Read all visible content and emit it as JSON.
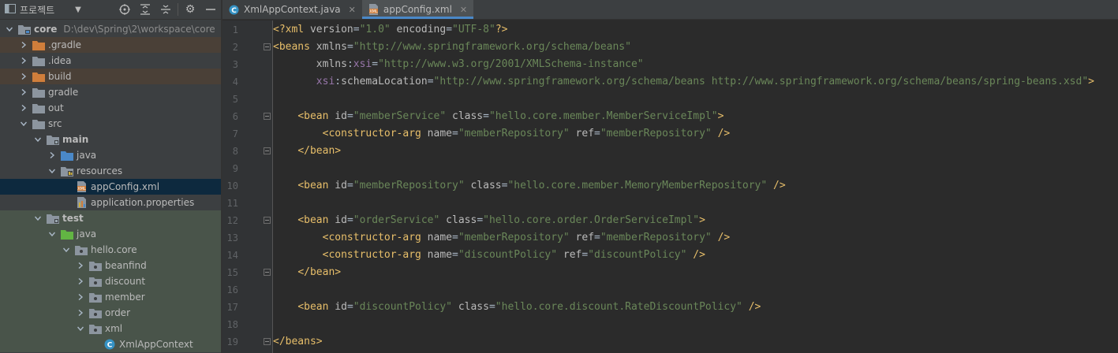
{
  "project_panel": {
    "title": "프로젝트",
    "tree": [
      {
        "id": "core",
        "label": "core",
        "path": "D:\\dev\\Spring\\2\\workspace\\core",
        "depth": 0,
        "type": "module",
        "expanded": true,
        "bold": true
      },
      {
        "id": "gradle-dot",
        "label": ".gradle",
        "depth": 1,
        "type": "folder-orange",
        "expanded": false,
        "bg": "excluded"
      },
      {
        "id": "idea",
        "label": ".idea",
        "depth": 1,
        "type": "folder",
        "expanded": false
      },
      {
        "id": "build",
        "label": "build",
        "depth": 1,
        "type": "folder-orange",
        "expanded": false,
        "bg": "excluded"
      },
      {
        "id": "gradle",
        "label": "gradle",
        "depth": 1,
        "type": "folder",
        "expanded": false
      },
      {
        "id": "out",
        "label": "out",
        "depth": 1,
        "type": "folder",
        "expanded": false
      },
      {
        "id": "src",
        "label": "src",
        "depth": 1,
        "type": "folder",
        "expanded": true
      },
      {
        "id": "main",
        "label": "main",
        "depth": 2,
        "type": "folder-src",
        "expanded": true,
        "bold": true
      },
      {
        "id": "main-java",
        "label": "java",
        "depth": 3,
        "type": "folder-blue",
        "expanded": false
      },
      {
        "id": "resources",
        "label": "resources",
        "depth": 3,
        "type": "folder-res",
        "expanded": true
      },
      {
        "id": "appconfig",
        "label": "appConfig.xml",
        "depth": 4,
        "type": "xml",
        "bg": "selected"
      },
      {
        "id": "app-props",
        "label": "application.properties",
        "depth": 4,
        "type": "props"
      },
      {
        "id": "test",
        "label": "test",
        "depth": 2,
        "type": "folder-src",
        "expanded": true,
        "bold": true,
        "bg": "testsrc"
      },
      {
        "id": "test-java",
        "label": "java",
        "depth": 3,
        "type": "folder-green",
        "expanded": true,
        "bg": "testsrc"
      },
      {
        "id": "hello-core",
        "label": "hello.core",
        "depth": 4,
        "type": "package",
        "expanded": true,
        "bg": "testsrc"
      },
      {
        "id": "beanfind",
        "label": "beanfind",
        "depth": 5,
        "type": "package",
        "expanded": false,
        "bg": "testsrc"
      },
      {
        "id": "discount",
        "label": "discount",
        "depth": 5,
        "type": "package",
        "expanded": false,
        "bg": "testsrc"
      },
      {
        "id": "member",
        "label": "member",
        "depth": 5,
        "type": "package",
        "expanded": false,
        "bg": "testsrc"
      },
      {
        "id": "order",
        "label": "order",
        "depth": 5,
        "type": "package",
        "expanded": false,
        "bg": "testsrc"
      },
      {
        "id": "xml",
        "label": "xml",
        "depth": 5,
        "type": "package",
        "expanded": true,
        "bg": "testsrc"
      },
      {
        "id": "xmlappcontext",
        "label": "XmlAppContext",
        "depth": 6,
        "type": "class",
        "bg": "testsrc"
      }
    ]
  },
  "tabs": [
    {
      "label": "XmlAppContext.java",
      "icon": "class-icon",
      "active": false
    },
    {
      "label": "appConfig.xml",
      "icon": "xml-file-icon",
      "active": true
    }
  ],
  "editor": {
    "fold_lines": [
      2,
      6,
      8,
      12,
      15,
      19
    ],
    "lines": [
      [
        [
          "ang",
          "<?"
        ],
        [
          "tag",
          "xml"
        ],
        [
          "attr",
          " version"
        ],
        [
          "txt",
          "="
        ],
        [
          "val",
          "\"1.0\""
        ],
        [
          "attr",
          " encoding"
        ],
        [
          "txt",
          "="
        ],
        [
          "val",
          "\"UTF-8\""
        ],
        [
          "ang",
          "?>"
        ]
      ],
      [
        [
          "ang",
          "<"
        ],
        [
          "tag",
          "beans"
        ],
        [
          "attr",
          " xmlns"
        ],
        [
          "txt",
          "="
        ],
        [
          "val",
          "\"http://www.springframework.org/schema/beans\""
        ]
      ],
      [
        [
          "txt",
          "       "
        ],
        [
          "attr",
          "xmlns"
        ],
        [
          "txt",
          ":"
        ],
        [
          "ns",
          "xsi"
        ],
        [
          "txt",
          "="
        ],
        [
          "val",
          "\"http://www.w3.org/2001/XMLSchema-instance\""
        ]
      ],
      [
        [
          "txt",
          "       "
        ],
        [
          "ns",
          "xsi"
        ],
        [
          "txt",
          ":"
        ],
        [
          "attr",
          "schemaLocation"
        ],
        [
          "txt",
          "="
        ],
        [
          "val",
          "\"http://www.springframework.org/schema/beans http://www.springframework.org/schema/beans/spring-beans.xsd\""
        ],
        [
          "ang",
          ">"
        ]
      ],
      [],
      [
        [
          "txt",
          "    "
        ],
        [
          "ang",
          "<"
        ],
        [
          "tag",
          "bean"
        ],
        [
          "attr",
          " id"
        ],
        [
          "txt",
          "="
        ],
        [
          "val",
          "\"memberService\""
        ],
        [
          "attr",
          " class"
        ],
        [
          "txt",
          "="
        ],
        [
          "val",
          "\"hello.core.member.MemberServiceImpl\""
        ],
        [
          "ang",
          ">"
        ]
      ],
      [
        [
          "txt",
          "        "
        ],
        [
          "ang",
          "<"
        ],
        [
          "tag",
          "constructor-arg"
        ],
        [
          "attr",
          " name"
        ],
        [
          "txt",
          "="
        ],
        [
          "val",
          "\"memberRepository\""
        ],
        [
          "attr",
          " ref"
        ],
        [
          "txt",
          "="
        ],
        [
          "val",
          "\"memberRepository\""
        ],
        [
          "ang",
          " />"
        ]
      ],
      [
        [
          "txt",
          "    "
        ],
        [
          "ang",
          "</"
        ],
        [
          "tag",
          "bean"
        ],
        [
          "ang",
          ">"
        ]
      ],
      [],
      [
        [
          "txt",
          "    "
        ],
        [
          "ang",
          "<"
        ],
        [
          "tag",
          "bean"
        ],
        [
          "attr",
          " id"
        ],
        [
          "txt",
          "="
        ],
        [
          "val",
          "\"memberRepository\""
        ],
        [
          "attr",
          " class"
        ],
        [
          "txt",
          "="
        ],
        [
          "val",
          "\"hello.core.member.MemoryMemberRepository\""
        ],
        [
          "ang",
          " />"
        ]
      ],
      [],
      [
        [
          "txt",
          "    "
        ],
        [
          "ang",
          "<"
        ],
        [
          "tag",
          "bean"
        ],
        [
          "attr",
          " id"
        ],
        [
          "txt",
          "="
        ],
        [
          "val",
          "\"orderService\""
        ],
        [
          "attr",
          " class"
        ],
        [
          "txt",
          "="
        ],
        [
          "val",
          "\"hello.core.order.OrderServiceImpl\""
        ],
        [
          "ang",
          ">"
        ]
      ],
      [
        [
          "txt",
          "        "
        ],
        [
          "ang",
          "<"
        ],
        [
          "tag",
          "constructor-arg"
        ],
        [
          "attr",
          " name"
        ],
        [
          "txt",
          "="
        ],
        [
          "val",
          "\"memberRepository\""
        ],
        [
          "attr",
          " ref"
        ],
        [
          "txt",
          "="
        ],
        [
          "val",
          "\"memberRepository\""
        ],
        [
          "ang",
          " />"
        ]
      ],
      [
        [
          "txt",
          "        "
        ],
        [
          "ang",
          "<"
        ],
        [
          "tag",
          "constructor-arg"
        ],
        [
          "attr",
          " name"
        ],
        [
          "txt",
          "="
        ],
        [
          "val",
          "\"discountPolicy\""
        ],
        [
          "attr",
          " ref"
        ],
        [
          "txt",
          "="
        ],
        [
          "val",
          "\"discountPolicy\""
        ],
        [
          "ang",
          " />"
        ]
      ],
      [
        [
          "txt",
          "    "
        ],
        [
          "ang",
          "</"
        ],
        [
          "tag",
          "bean"
        ],
        [
          "ang",
          ">"
        ]
      ],
      [],
      [
        [
          "txt",
          "    "
        ],
        [
          "ang",
          "<"
        ],
        [
          "tag",
          "bean"
        ],
        [
          "attr",
          " id"
        ],
        [
          "txt",
          "="
        ],
        [
          "val",
          "\"discountPolicy\""
        ],
        [
          "attr",
          " class"
        ],
        [
          "txt",
          "="
        ],
        [
          "val",
          "\"hello.core.discount.RateDiscountPolicy\""
        ],
        [
          "ang",
          " />"
        ]
      ],
      [],
      [
        [
          "ang",
          "</"
        ],
        [
          "tag",
          "beans"
        ],
        [
          "ang",
          ">"
        ]
      ]
    ]
  },
  "colors": {
    "folder": "#8c959f",
    "folder_orange": "#d07e3b",
    "folder_blue": "#4a88c7",
    "folder_green": "#62b543",
    "xml": "#d07e3b",
    "class": "#3592c4"
  }
}
